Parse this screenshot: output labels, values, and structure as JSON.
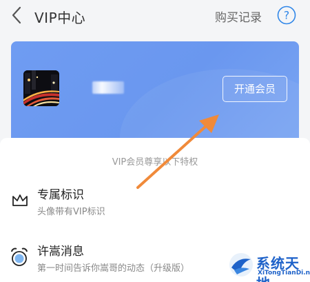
{
  "header": {
    "title": "VIP中心",
    "purchase_records": "购买记录",
    "help_symbol": "?"
  },
  "card": {
    "open_member_label": "开通会员"
  },
  "privileges": {
    "heading": "VIP会员尊享以下特权",
    "items": [
      {
        "icon": "crown-icon",
        "title": "专属标识",
        "desc": "头像带有VIP标识"
      },
      {
        "icon": "alarm-clock-icon",
        "title": "许嵩消息",
        "desc": "第一时间告诉你嵩哥的动态（升级版）"
      }
    ]
  },
  "watermark": {
    "name": "系统天地",
    "url": "XiTongTianDi.net"
  },
  "colors": {
    "card_blue": "#6f9cf2",
    "help_blue": "#2f86e8",
    "arrow_orange": "#f08a3a"
  }
}
